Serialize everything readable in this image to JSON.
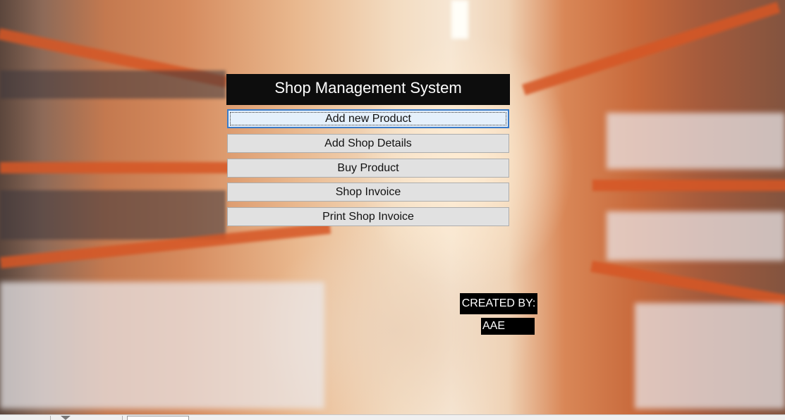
{
  "app": {
    "title": "Shop Management System"
  },
  "menu": {
    "items": [
      {
        "label": "Add new Product"
      },
      {
        "label": "Add Shop Details"
      },
      {
        "label": "Buy Product"
      },
      {
        "label": "Shop Invoice"
      },
      {
        "label": "Print Shop Invoice"
      }
    ]
  },
  "credits": {
    "label": "CREATED BY:",
    "name": "AAE"
  },
  "status_bar": {
    "icons": [
      "record-navigation",
      "filter-icon",
      "search-field"
    ]
  },
  "colors": {
    "title_bg": "#0d0d0d",
    "button_bg": "#e1e1e1",
    "focus_border": "#3a7bc8",
    "shelf_orange": "#d65625"
  }
}
